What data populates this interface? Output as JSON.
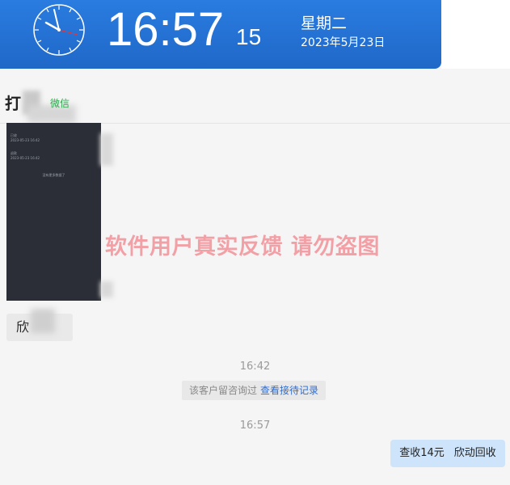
{
  "clock": {
    "time": "16:57",
    "seconds": "15",
    "weekday": "星期二",
    "date": "2023年5月23日"
  },
  "header": {
    "contact_name": "打",
    "platform": "微信"
  },
  "screenshot_message": {
    "line1": "已收",
    "line1_sub": "2023-05-23 16:42",
    "line2": "退款",
    "line2_sub": "2023-05-23 16:42",
    "center": "没有更多数据了"
  },
  "watermark": "软件用户真实反馈  请勿盗图",
  "incoming_text": "欣",
  "timestamps": [
    "16:42",
    "16:57"
  ],
  "notice": {
    "text": "该客户留咨询过",
    "link": "查看接待记录"
  },
  "outgoing": {
    "part1": "查收14元",
    "part2": "欣动回收"
  }
}
